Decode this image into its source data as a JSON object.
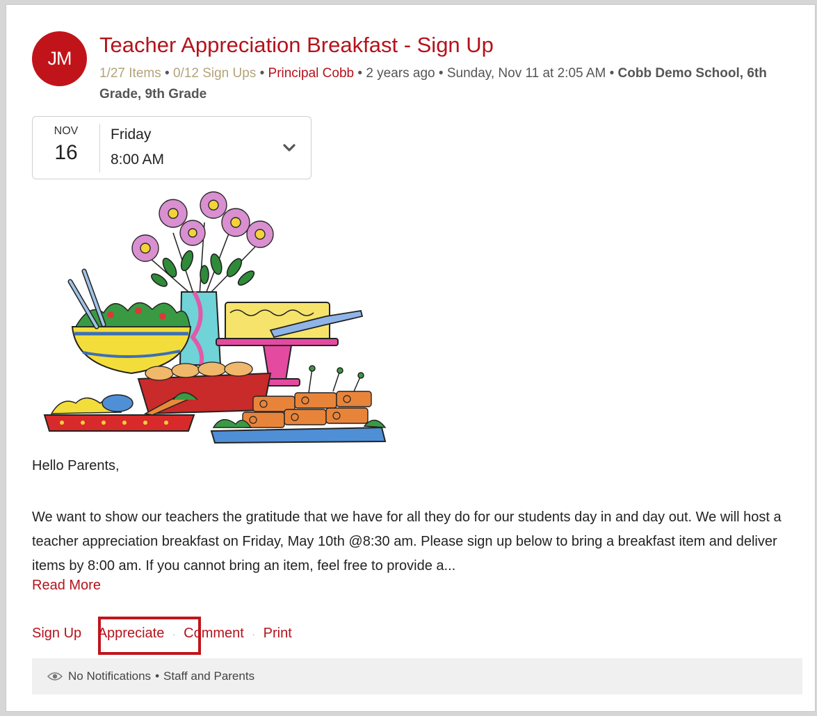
{
  "post": {
    "avatar_initials": "JM",
    "title": "Teacher Appreciation Breakfast - Sign Up",
    "meta": {
      "items": "1/27 Items",
      "signups": "0/12 Sign Ups",
      "author": "Principal Cobb",
      "age": "2 years ago",
      "datetime": "Sunday, Nov 11 at 2:05 AM",
      "groups": "Cobb Demo School, 6th Grade, 9th Grade",
      "separator": "•"
    }
  },
  "event": {
    "month": "NOV",
    "day": "16",
    "weekday": "Friday",
    "time": "8:00 AM"
  },
  "content": {
    "greeting": "Hello Parents,",
    "body": "We want to show our teachers the gratitude that we have for all they do for our students day in and day out. We will host a teacher appreciation breakfast on Friday, May 10th @8:30 am. Please sign up below to bring a breakfast item and deliver items by 8:00 am. If you cannot bring an item, feel free to provide a...",
    "read_more": "Read More"
  },
  "actions": {
    "sign_up": "Sign Up",
    "appreciate": "Appreciate",
    "comment": "Comment",
    "print": "Print",
    "dot": "·"
  },
  "footer": {
    "notifications": "No Notifications",
    "separator": "•",
    "audience": "Staff and Parents"
  },
  "colors": {
    "accent": "#b5121b",
    "avatar_bg": "#c1141a",
    "highlight_box": "#c1141a"
  },
  "icons": {
    "chevron": "chevron-down-icon",
    "eye": "eye-icon"
  }
}
